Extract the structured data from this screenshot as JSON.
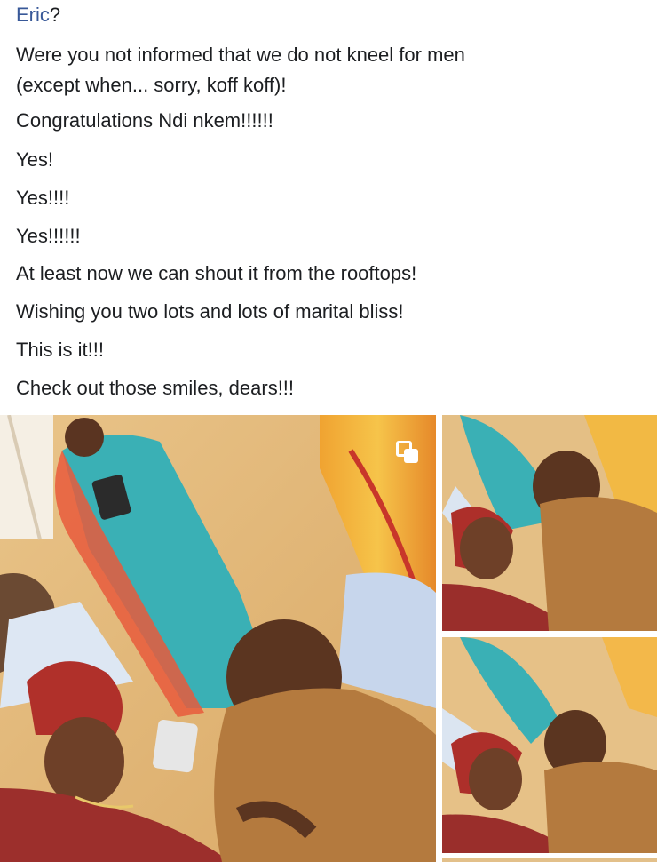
{
  "post": {
    "mention_name": "Eric",
    "mention_suffix": "?",
    "lines": [
      "Were you not informed that we do not kneel for men",
      "(except when... sorry, koff koff)!",
      "Congratulations Ndi nkem!!!!!!",
      "Yes!",
      "Yes!!!!",
      "Yes!!!!!!",
      "At least now we can shout it from the rooftops!",
      "Wishing you two lots and lots of marital bliss!",
      "This is it!!!",
      "Check out those smiles, dears!!!"
    ]
  },
  "photos": {
    "main_overlay_icon": "picture-in-picture-icon",
    "count": 3
  },
  "colors": {
    "mention": "#385898",
    "text": "#1c1e21"
  }
}
